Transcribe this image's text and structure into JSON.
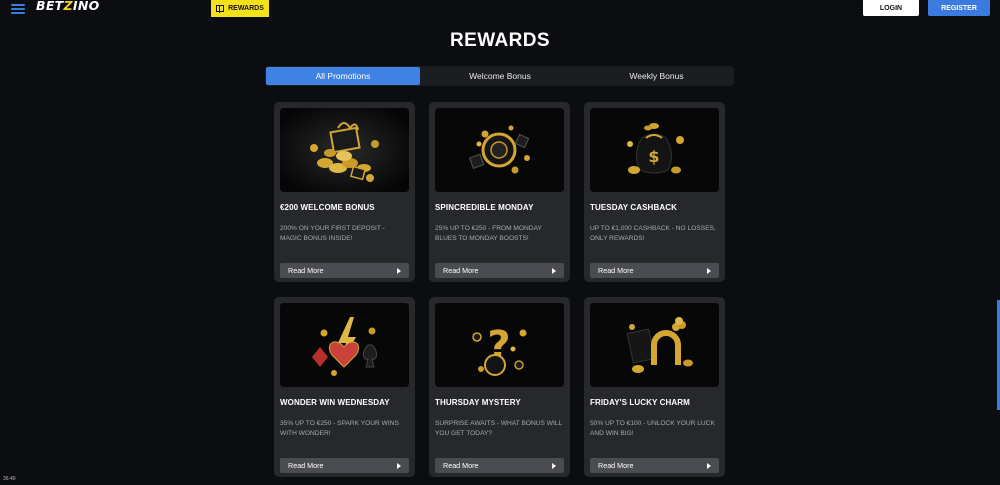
{
  "header": {
    "logo_left": "BET",
    "logo_z": "Z",
    "logo_right": "INO",
    "rewards_label": "REWARDS",
    "login_label": "LOGIN",
    "register_label": "REGISTER"
  },
  "title": "REWARDS",
  "tabs": [
    {
      "label": "All Promotions",
      "active": true
    },
    {
      "label": "Welcome Bonus",
      "active": false
    },
    {
      "label": "Weekly Bonus",
      "active": false
    }
  ],
  "cards": [
    {
      "title": "€200 WELCOME BONUS",
      "desc": "200% ON YOUR FIRST DEPOSIT - MAGIC BONUS INSIDE!",
      "button": "Read More",
      "image": "gift-box-coins-icon"
    },
    {
      "title": "SPINCREDIBLE MONDAY",
      "desc": "25% UP TO €250 - FROM MONDAY BLUES TO MONDAY BOOSTS!",
      "button": "Read More",
      "image": "roulette-dice-icon"
    },
    {
      "title": "TUESDAY CASHBACK",
      "desc": "UP TO €1,000 CASHBACK - NO LOSSES, ONLY REWARDS!",
      "button": "Read More",
      "image": "money-bag-icon"
    },
    {
      "title": "WONDER WIN WEDNESDAY",
      "desc": "35% UP TO €250 - SPARK YOUR WINS WITH WONDER!",
      "button": "Read More",
      "image": "card-suits-lightning-icon"
    },
    {
      "title": "THURSDAY MYSTERY",
      "desc": "SURPRISE AWAITS - WHAT BONUS WILL YOU GET TODAY?",
      "button": "Read More",
      "image": "question-mark-icon"
    },
    {
      "title": "FRIDAY'S LUCKY CHARM",
      "desc": "50% UP TO €100 - UNLOCK YOUR LUCK AND WIN BIG!",
      "button": "Read More",
      "image": "horseshoe-clover-icon"
    }
  ],
  "footer_time": "36:40",
  "colors": {
    "accent": "#4082e3",
    "brand_yellow": "#f5e11a",
    "card_bg": "#26282c",
    "page_bg": "#0c0d10",
    "gold": "#d4a632"
  }
}
